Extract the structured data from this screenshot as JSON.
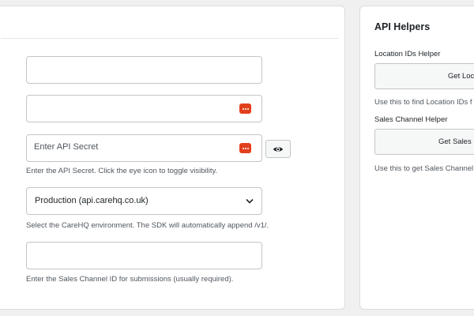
{
  "settings_form": {
    "api_secret": {
      "placeholder": "Enter API Secret",
      "hint": "Enter the API Secret. Click the eye icon to toggle visibility."
    },
    "environment": {
      "selected": "Production (api.carehq.co.uk)",
      "hint": "Select the CareHQ environment. The SDK will automatically append /v1/."
    },
    "sales_channel": {
      "hint": "Enter the Sales Channel ID for submissions (usually required)."
    }
  },
  "api_helpers": {
    "title": "API Helpers",
    "location": {
      "label": "Location IDs Helper",
      "button": "Get Loca",
      "hint": "Use this to find Location IDs f"
    },
    "sales_channel": {
      "label": "Sales Channel Helper",
      "button": "Get Sales C",
      "hint": "Use this to get Sales Channel"
    }
  },
  "colors": {
    "password_badge": "#e2401c",
    "page_background": "#f0f0f1"
  },
  "icons": {
    "password_manager": "password-manager-icon",
    "toggle_visibility": "eye-icon",
    "select_caret": "chevron-down-icon"
  }
}
